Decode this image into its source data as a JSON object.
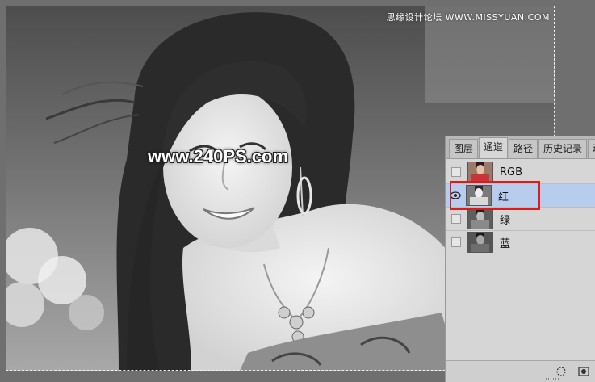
{
  "watermarks": {
    "top": "思缘设计论坛 WWW.MISSYUAN.COM",
    "main": "www.240PS.com"
  },
  "panel": {
    "tabs": [
      {
        "label": "图层",
        "active": false
      },
      {
        "label": "通道",
        "active": true
      },
      {
        "label": "路径",
        "active": false
      },
      {
        "label": "历史记录",
        "active": false
      },
      {
        "label": "动",
        "active": false
      }
    ],
    "channels": [
      {
        "label": "RGB",
        "visible": false,
        "selected": false
      },
      {
        "label": "红",
        "visible": true,
        "selected": true
      },
      {
        "label": "绿",
        "visible": false,
        "selected": false
      },
      {
        "label": "蓝",
        "visible": false,
        "selected": false
      }
    ],
    "bottom_icons": [
      "load-selection-icon",
      "save-selection-icon"
    ]
  },
  "colors": {
    "selected_row": "#b8ccee",
    "highlight_box": "#e01a1a",
    "workspace": "#6f6f6f"
  }
}
